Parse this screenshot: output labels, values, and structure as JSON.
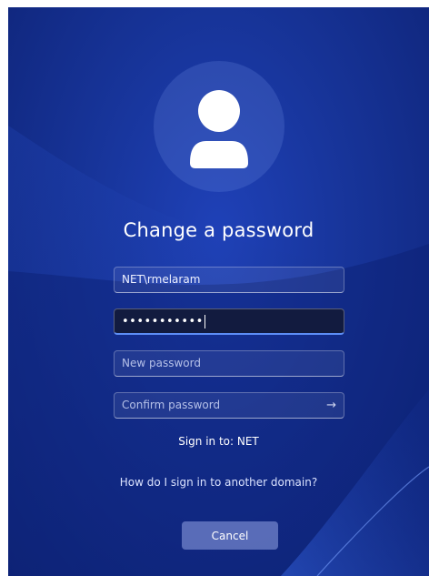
{
  "title": "Change a password",
  "fields": {
    "username_value": "NET\\rmelaram",
    "old_password_mask": "•••••••••••",
    "new_password_placeholder": "New password",
    "confirm_password_placeholder": "Confirm password"
  },
  "icons": {
    "avatar": "user-avatar-icon",
    "submit": "arrow-right-icon",
    "submit_glyph": "→"
  },
  "sign_in_to": "Sign in to: NET",
  "other_domain_link": "How do I sign in to another domain?",
  "cancel_label": "Cancel",
  "colors": {
    "background": "#173499",
    "focus_accent": "#5c8df5",
    "button": "#8f9ee6"
  }
}
